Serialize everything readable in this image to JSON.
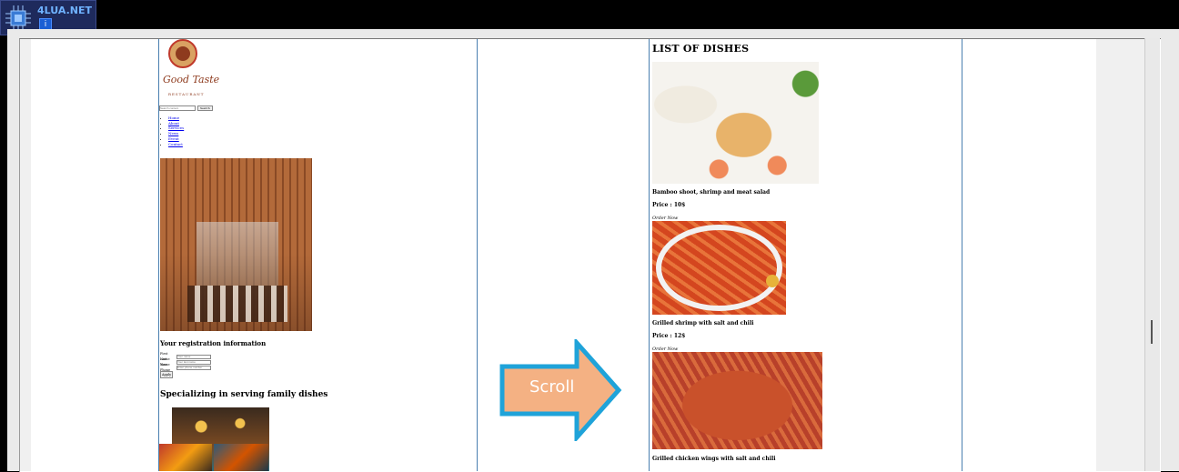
{
  "watermark": {
    "brand": "4LUA.NET",
    "button": "i"
  },
  "restaurant_page": {
    "logo": {
      "name": "Good Taste",
      "tagline": "RESTAURANT"
    },
    "search": {
      "placeholder": "Search content",
      "button": "Search"
    },
    "nav": [
      "Home",
      "About",
      "Services",
      "News",
      "Event",
      "Contact"
    ],
    "registration_title": "Your registration information",
    "form": {
      "first_name_label": "First Name",
      "first_name_placeholder": "Your name",
      "last_name_label": "Last Name",
      "last_name_placeholder": "Your last name",
      "phone_label": "Your Phone",
      "phone_placeholder": "Enter phone number",
      "apply": "Apply"
    },
    "specializing_title": "Specializing in serving family dishes"
  },
  "scroll_arrow": {
    "label": "Scroll",
    "fill": "#f4b183",
    "stroke": "#1fa3d9"
  },
  "dish_list": {
    "title": "LIST OF DISHES",
    "dishes": [
      {
        "name": "Bamboo shoot, shrimp and meat salad",
        "price": "Price : 10$",
        "order": "Order Now"
      },
      {
        "name": "Grilled shrimp with salt and chili",
        "price": "Price : 12$",
        "order": "Order Now"
      },
      {
        "name": "Grilled chicken wings with salt and chili"
      }
    ]
  },
  "colors": {
    "column_border": "#4a7fb0",
    "link": "#0000ee"
  }
}
